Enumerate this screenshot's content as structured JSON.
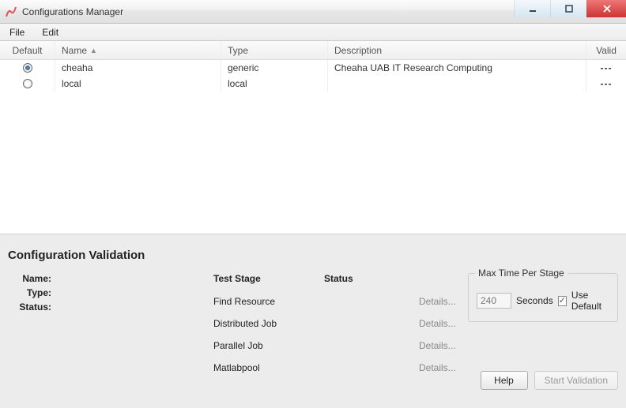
{
  "window": {
    "title": "Configurations Manager"
  },
  "menu": {
    "file": "File",
    "edit": "Edit"
  },
  "table": {
    "headers": {
      "default": "Default",
      "name": "Name",
      "type": "Type",
      "description": "Description",
      "valid": "Valid"
    },
    "rows": [
      {
        "default": true,
        "name": "cheaha",
        "type": "generic",
        "description": "Cheaha UAB IT Research Computing",
        "valid": "---"
      },
      {
        "default": false,
        "name": "local",
        "type": "local",
        "description": "",
        "valid": "---"
      }
    ]
  },
  "validation": {
    "section_title": "Configuration Validation",
    "labels": {
      "name": "Name:",
      "type": "Type:",
      "status": "Status:"
    },
    "values": {
      "name": "",
      "type": "",
      "status": ""
    },
    "stage_headers": {
      "stage": "Test Stage",
      "status": "Status"
    },
    "stages": [
      {
        "name": "Find Resource",
        "details": "Details..."
      },
      {
        "name": "Distributed Job",
        "details": "Details..."
      },
      {
        "name": "Parallel Job",
        "details": "Details..."
      },
      {
        "name": "Matlabpool",
        "details": "Details..."
      }
    ],
    "max_time": {
      "legend": "Max Time Per Stage",
      "value": "240",
      "unit": "Seconds",
      "use_default_label": "Use Default",
      "use_default_checked": true
    },
    "buttons": {
      "help": "Help",
      "start": "Start Validation"
    }
  }
}
